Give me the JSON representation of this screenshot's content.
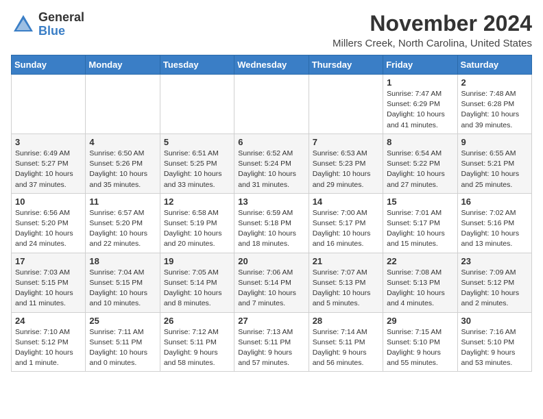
{
  "logo": {
    "general": "General",
    "blue": "Blue"
  },
  "header": {
    "month": "November 2024",
    "location": "Millers Creek, North Carolina, United States"
  },
  "weekdays": [
    "Sunday",
    "Monday",
    "Tuesday",
    "Wednesday",
    "Thursday",
    "Friday",
    "Saturday"
  ],
  "weeks": [
    [
      {
        "day": "",
        "info": ""
      },
      {
        "day": "",
        "info": ""
      },
      {
        "day": "",
        "info": ""
      },
      {
        "day": "",
        "info": ""
      },
      {
        "day": "",
        "info": ""
      },
      {
        "day": "1",
        "info": "Sunrise: 7:47 AM\nSunset: 6:29 PM\nDaylight: 10 hours\nand 41 minutes."
      },
      {
        "day": "2",
        "info": "Sunrise: 7:48 AM\nSunset: 6:28 PM\nDaylight: 10 hours\nand 39 minutes."
      }
    ],
    [
      {
        "day": "3",
        "info": "Sunrise: 6:49 AM\nSunset: 5:27 PM\nDaylight: 10 hours\nand 37 minutes."
      },
      {
        "day": "4",
        "info": "Sunrise: 6:50 AM\nSunset: 5:26 PM\nDaylight: 10 hours\nand 35 minutes."
      },
      {
        "day": "5",
        "info": "Sunrise: 6:51 AM\nSunset: 5:25 PM\nDaylight: 10 hours\nand 33 minutes."
      },
      {
        "day": "6",
        "info": "Sunrise: 6:52 AM\nSunset: 5:24 PM\nDaylight: 10 hours\nand 31 minutes."
      },
      {
        "day": "7",
        "info": "Sunrise: 6:53 AM\nSunset: 5:23 PM\nDaylight: 10 hours\nand 29 minutes."
      },
      {
        "day": "8",
        "info": "Sunrise: 6:54 AM\nSunset: 5:22 PM\nDaylight: 10 hours\nand 27 minutes."
      },
      {
        "day": "9",
        "info": "Sunrise: 6:55 AM\nSunset: 5:21 PM\nDaylight: 10 hours\nand 25 minutes."
      }
    ],
    [
      {
        "day": "10",
        "info": "Sunrise: 6:56 AM\nSunset: 5:20 PM\nDaylight: 10 hours\nand 24 minutes."
      },
      {
        "day": "11",
        "info": "Sunrise: 6:57 AM\nSunset: 5:20 PM\nDaylight: 10 hours\nand 22 minutes."
      },
      {
        "day": "12",
        "info": "Sunrise: 6:58 AM\nSunset: 5:19 PM\nDaylight: 10 hours\nand 20 minutes."
      },
      {
        "day": "13",
        "info": "Sunrise: 6:59 AM\nSunset: 5:18 PM\nDaylight: 10 hours\nand 18 minutes."
      },
      {
        "day": "14",
        "info": "Sunrise: 7:00 AM\nSunset: 5:17 PM\nDaylight: 10 hours\nand 16 minutes."
      },
      {
        "day": "15",
        "info": "Sunrise: 7:01 AM\nSunset: 5:17 PM\nDaylight: 10 hours\nand 15 minutes."
      },
      {
        "day": "16",
        "info": "Sunrise: 7:02 AM\nSunset: 5:16 PM\nDaylight: 10 hours\nand 13 minutes."
      }
    ],
    [
      {
        "day": "17",
        "info": "Sunrise: 7:03 AM\nSunset: 5:15 PM\nDaylight: 10 hours\nand 11 minutes."
      },
      {
        "day": "18",
        "info": "Sunrise: 7:04 AM\nSunset: 5:15 PM\nDaylight: 10 hours\nand 10 minutes."
      },
      {
        "day": "19",
        "info": "Sunrise: 7:05 AM\nSunset: 5:14 PM\nDaylight: 10 hours\nand 8 minutes."
      },
      {
        "day": "20",
        "info": "Sunrise: 7:06 AM\nSunset: 5:14 PM\nDaylight: 10 hours\nand 7 minutes."
      },
      {
        "day": "21",
        "info": "Sunrise: 7:07 AM\nSunset: 5:13 PM\nDaylight: 10 hours\nand 5 minutes."
      },
      {
        "day": "22",
        "info": "Sunrise: 7:08 AM\nSunset: 5:13 PM\nDaylight: 10 hours\nand 4 minutes."
      },
      {
        "day": "23",
        "info": "Sunrise: 7:09 AM\nSunset: 5:12 PM\nDaylight: 10 hours\nand 2 minutes."
      }
    ],
    [
      {
        "day": "24",
        "info": "Sunrise: 7:10 AM\nSunset: 5:12 PM\nDaylight: 10 hours\nand 1 minute."
      },
      {
        "day": "25",
        "info": "Sunrise: 7:11 AM\nSunset: 5:11 PM\nDaylight: 10 hours\nand 0 minutes."
      },
      {
        "day": "26",
        "info": "Sunrise: 7:12 AM\nSunset: 5:11 PM\nDaylight: 9 hours\nand 58 minutes."
      },
      {
        "day": "27",
        "info": "Sunrise: 7:13 AM\nSunset: 5:11 PM\nDaylight: 9 hours\nand 57 minutes."
      },
      {
        "day": "28",
        "info": "Sunrise: 7:14 AM\nSunset: 5:11 PM\nDaylight: 9 hours\nand 56 minutes."
      },
      {
        "day": "29",
        "info": "Sunrise: 7:15 AM\nSunset: 5:10 PM\nDaylight: 9 hours\nand 55 minutes."
      },
      {
        "day": "30",
        "info": "Sunrise: 7:16 AM\nSunset: 5:10 PM\nDaylight: 9 hours\nand 53 minutes."
      }
    ]
  ]
}
